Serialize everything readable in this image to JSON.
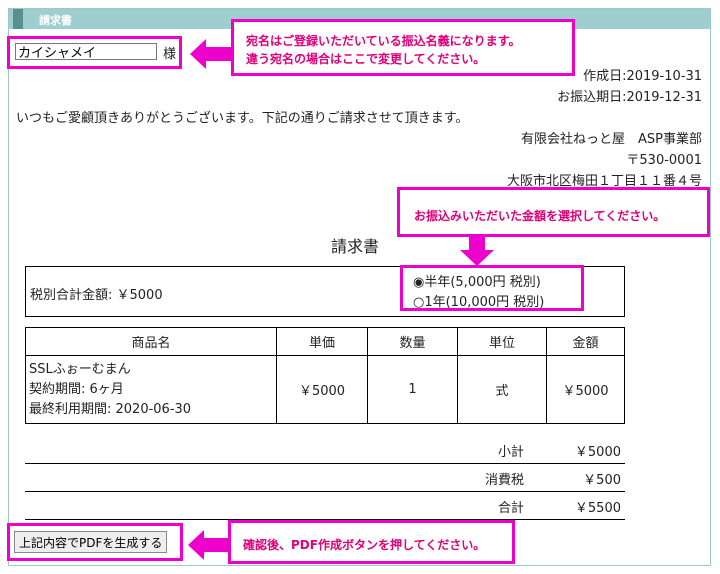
{
  "header": {
    "title": "請求書"
  },
  "recipient": {
    "name_value": "カイシャメイ",
    "honorific": "様"
  },
  "dates": {
    "created": "作成日:2019-10-31",
    "transfer": "お振込期日:2019-12-31"
  },
  "greeting": "いつもご愛顧頂きありがとうございます。下記の通りご請求させて頂きます。",
  "issuer": {
    "company": "有限会社ねっと屋　ASP事業部",
    "postal": "〒530-0001",
    "address": "大阪市北区梅田１丁目１１番４号"
  },
  "invoice_title": "請求書",
  "total_box": {
    "label": "税別合計金額: ￥5000",
    "options": [
      {
        "label": "半年(5,000円 税別)",
        "selected": true
      },
      {
        "label": "1年(10,000円 税別)",
        "selected": false
      }
    ]
  },
  "items_table": {
    "headers": [
      "商品名",
      "単価",
      "数量",
      "単位",
      "金額"
    ],
    "rows": [
      {
        "name_lines": [
          "SSLふぉーむまん",
          "契約期間: 6ヶ月",
          "最終利用期間: 2020-06-30"
        ],
        "unit_price": "￥5000",
        "quantity": "1",
        "unit": "式",
        "amount": "￥5000"
      }
    ]
  },
  "summary": [
    {
      "label": "小計",
      "value": "￥5000"
    },
    {
      "label": "消費税",
      "value": "￥500"
    },
    {
      "label": "合計",
      "value": "￥5500"
    }
  ],
  "pdf_button": "上記内容でPDFを生成する",
  "annotations": {
    "name_note_line1": "宛名はご登録いただいている振込名義になります。",
    "name_note_line2": "違う宛名の場合はここで変更してください。",
    "amount_note": "お振込みいただいた金額を選択してください。",
    "pdf_note": "確認後、PDF作成ボタンを押してください。"
  },
  "colors": {
    "accent": "#ee00cc",
    "header": "#9ecece",
    "header_bar": "#5a8f8f",
    "note_text": "#e0007a"
  }
}
